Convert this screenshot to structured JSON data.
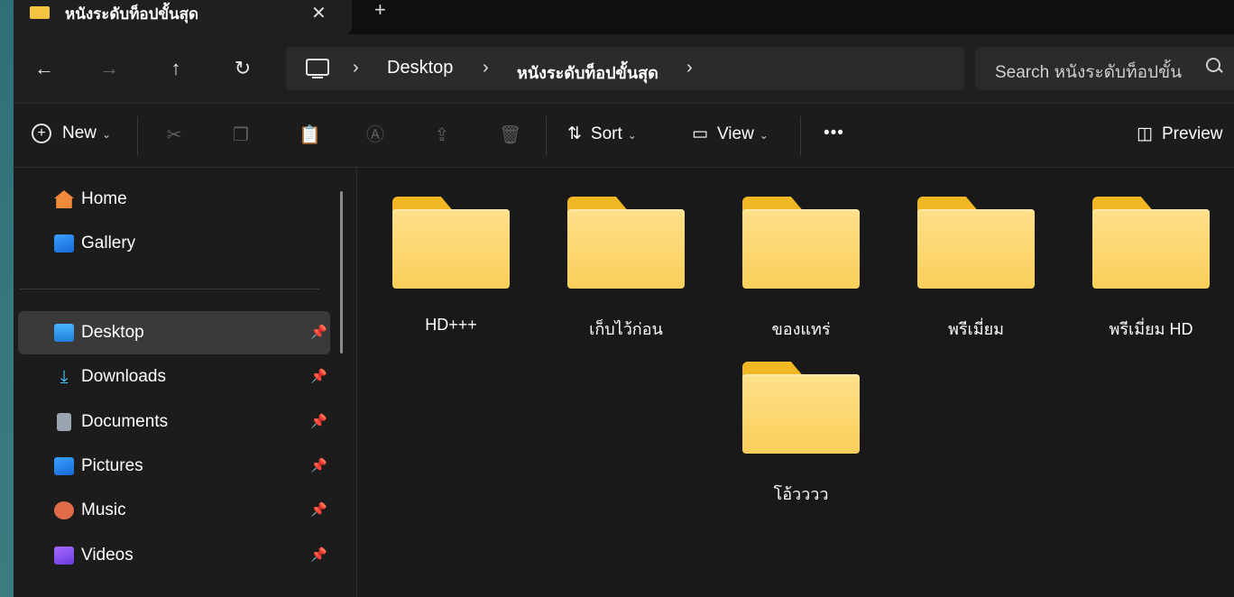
{
  "tab": {
    "title": "หนังระดับท็อปขั้นสุด",
    "close": "✕",
    "new": "+"
  },
  "nav": {
    "back": "←",
    "forward": "→",
    "up": "↑",
    "refresh": "↻"
  },
  "breadcrumb": {
    "sep": "›",
    "items": [
      "Desktop",
      "หนังระดับท็อปขั้นสุด"
    ]
  },
  "search": {
    "placeholder": "Search หนังระดับท็อปขั้น"
  },
  "toolbar": {
    "new_label": "New",
    "sort_label": "Sort",
    "view_label": "View",
    "more": "•••",
    "preview_label": "Preview"
  },
  "sidebar": {
    "items": [
      {
        "label": "Home",
        "icon": "home-icon",
        "pinned": false
      },
      {
        "label": "Gallery",
        "icon": "gallery-icon",
        "pinned": false
      },
      {
        "label": "Desktop",
        "icon": "desktop-icon",
        "pinned": true,
        "selected": true
      },
      {
        "label": "Downloads",
        "icon": "download-icon",
        "pinned": true
      },
      {
        "label": "Documents",
        "icon": "documents-icon",
        "pinned": true
      },
      {
        "label": "Pictures",
        "icon": "pictures-icon",
        "pinned": true
      },
      {
        "label": "Music",
        "icon": "music-icon",
        "pinned": true
      },
      {
        "label": "Videos",
        "icon": "videos-icon",
        "pinned": true
      }
    ]
  },
  "folders": [
    {
      "name": "HD+++"
    },
    {
      "name": "เก็บไว้ก่อน"
    },
    {
      "name": "ของแทร่"
    },
    {
      "name": "พรีเมี่ยม"
    },
    {
      "name": "พรีเมี่ยม HD"
    },
    {
      "name": "โอ้วววว"
    }
  ],
  "colors": {
    "accent": "#f5c342",
    "window_bg": "#1c1c1c",
    "selected_bg": "#3a3a3a"
  }
}
